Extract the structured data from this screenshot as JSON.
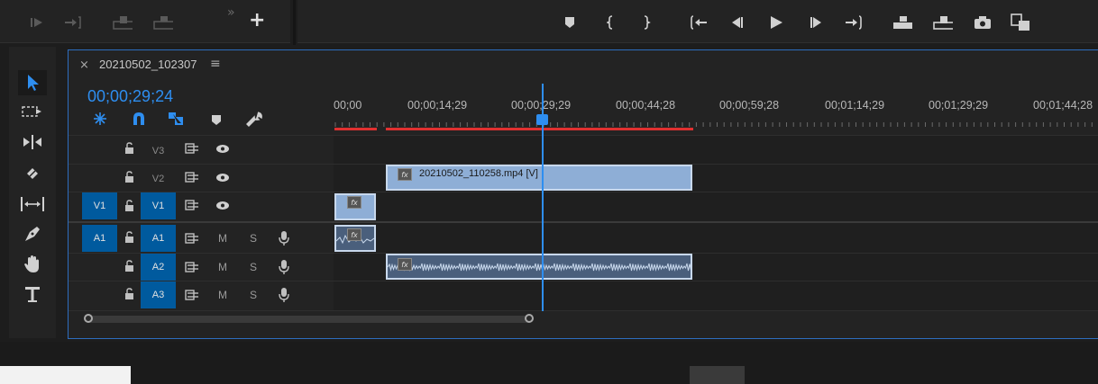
{
  "top_left_toolbar": {
    "icons": [
      "step-forward-icon",
      "go-to-out-icon",
      "lift-icon",
      "extract-icon",
      "more-icon",
      "add-button-icon"
    ],
    "more_label": "»",
    "add_label": "+"
  },
  "transport_toolbar": {
    "icons": [
      "add-marker-icon",
      "mark-in-icon",
      "mark-out-icon",
      "go-to-in-icon",
      "step-back-icon",
      "play-icon",
      "step-forward-icon",
      "go-to-out-icon",
      "lift-icon",
      "extract-icon",
      "export-frame-icon",
      "comparison-view-icon"
    ]
  },
  "tools": [
    "selection-tool-icon",
    "track-select-forward-icon",
    "ripple-edit-icon",
    "razor-icon",
    "slip-icon",
    "pen-icon",
    "hand-icon",
    "type-tool-icon"
  ],
  "sequence": {
    "close_label": "×",
    "name": "20210502_102307",
    "menu_label": "≡",
    "timecode": "00;00;29;24"
  },
  "ruler": {
    "labels": [
      "00;00",
      "00;00;14;29",
      "00;00;29;29",
      "00;00;44;28",
      "00;00;59;28",
      "00;01;14;29",
      "00;01;29;29",
      "00;01;44;28"
    ]
  },
  "tracks": [
    {
      "source": "",
      "lock": "🔓",
      "name": "V3",
      "kind": "video"
    },
    {
      "source": "",
      "lock": "🔓",
      "name": "V2",
      "kind": "video"
    },
    {
      "source": "V1",
      "lock": "🔓",
      "name": "V1",
      "kind": "video"
    },
    {
      "source": "A1",
      "lock": "🔓",
      "name": "A1",
      "kind": "audio"
    },
    {
      "source": "",
      "lock": "🔓",
      "name": "A2",
      "kind": "audio"
    },
    {
      "source": "",
      "lock": "🔓",
      "name": "A3",
      "kind": "audio"
    }
  ],
  "audio_toggles": {
    "mute": "M",
    "solo": "S"
  },
  "clips": {
    "v2_clip_name": "20210502_110258.mp4 [V]",
    "fx_label": "fx"
  },
  "colors": {
    "accent": "#2e8ef0",
    "panel_border": "#2d6dbf",
    "track_target": "#005a9e",
    "video_clip": "#8eaed6",
    "audio_clip": "#4a5f7c",
    "render_bar": "#e03030"
  }
}
